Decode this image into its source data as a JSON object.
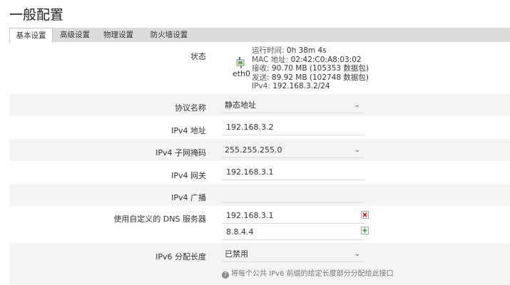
{
  "page": {
    "title": "一般配置"
  },
  "tabs": [
    {
      "label": "基本设置",
      "active": true
    },
    {
      "label": "高级设置",
      "active": false
    },
    {
      "label": "物理设置",
      "active": false
    },
    {
      "label": "防火墙设置",
      "active": false
    }
  ],
  "status": {
    "label": "状态",
    "interface": "eth0",
    "uptime_label": "运行时间:",
    "uptime_value": "0h 38m 4s",
    "mac_label": "MAC 地址:",
    "mac_value": "02:42:C0:A8:03:02",
    "rx_label": "接收:",
    "rx_value": "90.70 MB (105353 数据包)",
    "tx_label": "发送:",
    "tx_value": "89.92 MB (102748 数据包)",
    "ipv4_label": "IPv4:",
    "ipv4_value": "192.168.3.2/24"
  },
  "protocol": {
    "label": "协议名称",
    "value": "静态地址"
  },
  "ipv4_address": {
    "label": "IPv4 地址",
    "value": "192.168.3.2"
  },
  "ipv4_netmask": {
    "label": "IPv4 子网掩码",
    "value": "255.255.255.0"
  },
  "ipv4_gateway": {
    "label": "IPv4 网关",
    "value": "192.168.3.1"
  },
  "ipv4_broadcast": {
    "label": "IPv4 广播",
    "value": ""
  },
  "dns": {
    "label": "使用自定义的 DNS 服务器",
    "servers": [
      "192.168.3.1",
      "8.8.4.4"
    ]
  },
  "ipv6_assign": {
    "label": "IPv6 分配长度",
    "value": "已禁用",
    "hint": "将每个公共 IPv6 前缀的给定长度部分分配给此接口"
  },
  "icons": {
    "remove_color": "#cc2222",
    "add_color": "#2a9d3a"
  }
}
